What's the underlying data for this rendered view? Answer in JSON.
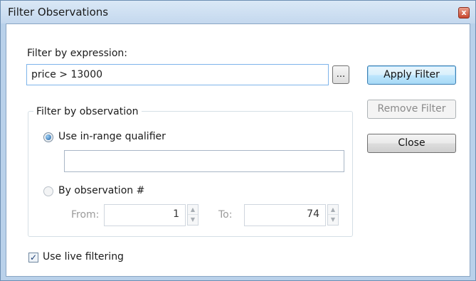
{
  "window": {
    "title": "Filter Observations",
    "close_label": "x"
  },
  "expression": {
    "label": "Filter by expression:",
    "value": "price > 13000",
    "browse_label": "..."
  },
  "buttons": {
    "apply": "Apply Filter",
    "remove": "Remove Filter",
    "close": "Close"
  },
  "observation_group": {
    "title": "Filter by observation",
    "in_range": {
      "label": "Use in-range qualifier",
      "selected": true,
      "value": ""
    },
    "by_number": {
      "label": "By observation #",
      "selected": false
    },
    "from": {
      "label": "From:",
      "value": "1"
    },
    "to": {
      "label": "To:",
      "value": "74"
    }
  },
  "live_filtering": {
    "label": "Use live filtering",
    "checked": true
  },
  "icons": {
    "spinner_up": "spin-up-icon",
    "spinner_down": "spin-down-icon"
  }
}
